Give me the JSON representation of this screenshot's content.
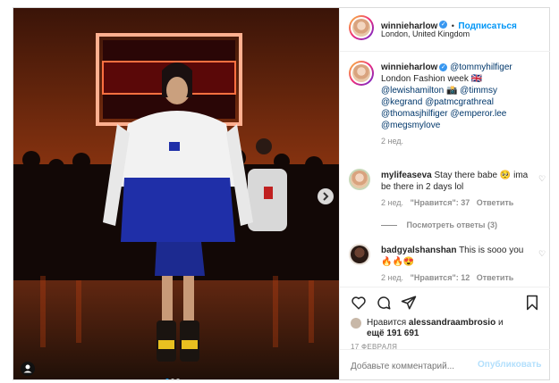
{
  "header": {
    "username": "winnieharlow",
    "separator": "•",
    "follow_label": "Подписаться",
    "location": "London, United Kingdom"
  },
  "caption": {
    "username": "winnieharlow",
    "line1_mention": "@tommyhilfiger",
    "line2": "London Fashion week 🇬🇧",
    "line3_a": "@lewishamilton 📸 @timmsy",
    "line4": "@kegrand @patmcgrathreal",
    "line5": "@thomasjhilfiger @emperor.lee",
    "line6": "@megsmylove",
    "time": "2 нед."
  },
  "comments": [
    {
      "username": "mylifeaseva",
      "text": "Stay there babe 🥺 ima be there in 2 days lol",
      "time": "2 нед.",
      "likes": "\"Нравится\": 37",
      "reply": "Ответить",
      "view_replies": "Посмотреть ответы (3)"
    },
    {
      "username": "badgyalshanshan",
      "text": "This is sooo you 🔥🔥😍",
      "time": "2 нед.",
      "likes": "\"Нравится\": 12",
      "reply": "Ответить"
    }
  ],
  "likes": {
    "prefix": "Нравится",
    "user": "alessandraambrosio",
    "suffix": "и",
    "count_text": "ещё 191 691"
  },
  "date": "17 ФЕВРАЛЯ",
  "add_comment": {
    "placeholder": "Добавьте комментарий...",
    "publish_label": "Опубликовать"
  },
  "colors": {
    "accent": "#0095f6",
    "publish_disabled": "#b2dffc",
    "muted": "#8e8e8e",
    "border": "#dbdbdb"
  },
  "icons": [
    "heart-icon",
    "comment-icon",
    "share-icon",
    "bookmark-icon",
    "next-arrow-icon",
    "user-tag-icon",
    "verified-badge-icon"
  ]
}
